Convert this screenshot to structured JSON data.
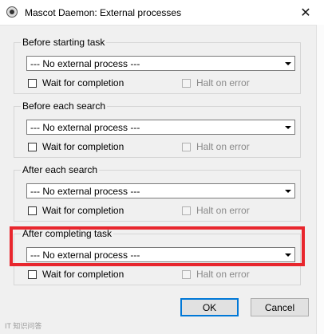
{
  "window": {
    "title": "Mascot Daemon: External processes",
    "close_glyph": "✕",
    "icon": "mascot-daemon-icon"
  },
  "groups": [
    {
      "legend": "Before starting task",
      "process": "--- No external process ---",
      "wait_label": "Wait for completion",
      "wait_checked": false,
      "halt_label": "Halt on error",
      "halt_enabled": false
    },
    {
      "legend": "Before each search",
      "process": "--- No external process ---",
      "wait_label": "Wait for completion",
      "wait_checked": false,
      "halt_label": "Halt on error",
      "halt_enabled": false
    },
    {
      "legend": "After each search",
      "process": "--- No external process ---",
      "wait_label": "Wait for completion",
      "wait_checked": false,
      "halt_label": "Halt on error",
      "halt_enabled": false
    },
    {
      "legend": "After completing task",
      "process": "--- No external process ---",
      "wait_label": "Wait for completion",
      "wait_checked": false,
      "halt_label": "Halt on error",
      "halt_enabled": false
    }
  ],
  "buttons": {
    "ok": "OK",
    "cancel": "Cancel"
  },
  "highlight_color": "#e8262d",
  "watermark": "IT 知识问答"
}
